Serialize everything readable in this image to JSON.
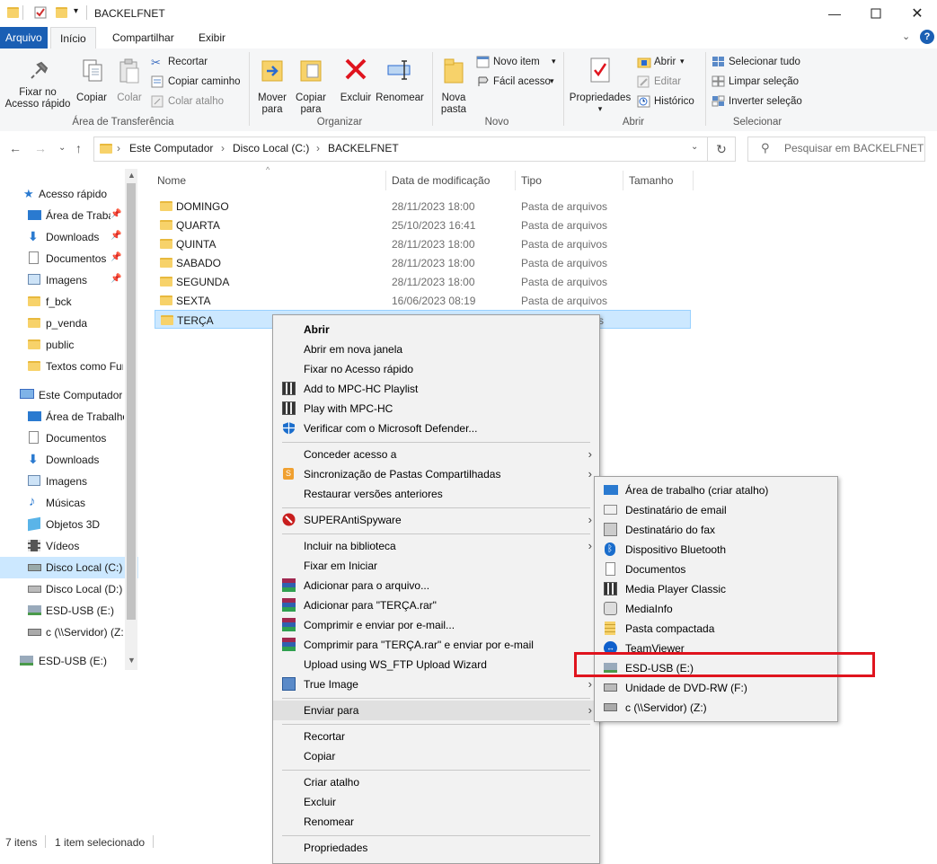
{
  "window": {
    "title": "BACKELFNET"
  },
  "tabs": [
    {
      "label": "Arquivo"
    },
    {
      "label": "Início"
    },
    {
      "label": "Compartilhar"
    },
    {
      "label": "Exibir"
    }
  ],
  "ribbon": {
    "clipboard": {
      "pin_label_1": "Fixar no",
      "pin_label_2": "Acesso rápido",
      "copy": "Copiar",
      "paste": "Colar",
      "cut": "Recortar",
      "copy_path": "Copiar caminho",
      "paste_shortcut": "Colar atalho",
      "group": "Área de Transferência"
    },
    "organize": {
      "move_1": "Mover",
      "move_2": "para",
      "copyto_1": "Copiar",
      "copyto_2": "para",
      "delete": "Excluir",
      "rename": "Renomear",
      "group": "Organizar"
    },
    "new": {
      "folder_1": "Nova",
      "folder_2": "pasta",
      "new_item": "Novo item",
      "easy_access": "Fácil acesso",
      "group": "Novo"
    },
    "open": {
      "properties": "Propriedades",
      "open": "Abrir",
      "edit": "Editar",
      "history": "Histórico",
      "group": "Abrir"
    },
    "select": {
      "all": "Selecionar tudo",
      "none": "Limpar seleção",
      "invert": "Inverter seleção",
      "group": "Selecionar"
    }
  },
  "address": {
    "crumbs": [
      "Este Computador",
      "Disco Local (C:)",
      "BACKELFNET"
    ],
    "search_placeholder": "Pesquisar em BACKELFNET"
  },
  "nav": [
    {
      "label": "Acesso rápido"
    },
    {
      "label": "Área de Traba"
    },
    {
      "label": "Downloads"
    },
    {
      "label": "Documentos"
    },
    {
      "label": "Imagens"
    },
    {
      "label": "f_bck"
    },
    {
      "label": "p_venda"
    },
    {
      "label": "public"
    },
    {
      "label": "Textos como Fun"
    },
    {
      "label": "Este Computador"
    },
    {
      "label": "Área de Trabalho"
    },
    {
      "label": "Documentos"
    },
    {
      "label": "Downloads"
    },
    {
      "label": "Imagens"
    },
    {
      "label": "Músicas"
    },
    {
      "label": "Objetos 3D"
    },
    {
      "label": "Vídeos"
    },
    {
      "label": "Disco Local (C:)"
    },
    {
      "label": "Disco Local (D:)"
    },
    {
      "label": "ESD-USB (E:)"
    },
    {
      "label": "c (\\\\Servidor) (Z:"
    },
    {
      "label": "ESD-USB (E:)"
    }
  ],
  "columns": {
    "name": "Nome",
    "date": "Data de modificação",
    "type": "Tipo",
    "size": "Tamanho"
  },
  "files": [
    {
      "name": "DOMINGO",
      "date": "28/11/2023 18:00",
      "type": "Pasta de arquivos"
    },
    {
      "name": "QUARTA",
      "date": "25/10/2023 16:41",
      "type": "Pasta de arquivos"
    },
    {
      "name": "QUINTA",
      "date": "28/11/2023 18:00",
      "type": "Pasta de arquivos"
    },
    {
      "name": "SABADO",
      "date": "28/11/2023 18:00",
      "type": "Pasta de arquivos"
    },
    {
      "name": "SEGUNDA",
      "date": "28/11/2023 18:00",
      "type": "Pasta de arquivos"
    },
    {
      "name": "SEXTA",
      "date": "16/06/2023 08:19",
      "type": "Pasta de arquivos"
    },
    {
      "name": "TERÇA",
      "date": "",
      "type": "s"
    }
  ],
  "status": {
    "count": "7 itens",
    "selected": "1 item selecionado"
  },
  "context_menu": [
    "Abrir",
    "Abrir em nova janela",
    "Fixar no Acesso rápido",
    "Add to MPC-HC Playlist",
    "Play with MPC-HC",
    "Verificar com o Microsoft Defender...",
    "Conceder acesso a",
    "Sincronização de Pastas Compartilhadas",
    "Restaurar versões anteriores",
    "SUPERAntiSpyware",
    "Incluir na biblioteca",
    "Fixar em Iniciar",
    "Adicionar para o arquivo...",
    "Adicionar para \"TERÇA.rar\"",
    "Comprimir e enviar por e-mail...",
    "Comprimir para \"TERÇA.rar\" e enviar por e-mail",
    "Upload using WS_FTP Upload Wizard",
    "True Image",
    "Enviar para",
    "Recortar",
    "Copiar",
    "Criar atalho",
    "Excluir",
    "Renomear",
    "Propriedades"
  ],
  "sendto_menu": [
    "Área de trabalho (criar atalho)",
    "Destinatário de email",
    "Destinatário do fax",
    "Dispositivo Bluetooth",
    "Documentos",
    "Media Player Classic",
    "MediaInfo",
    "Pasta compactada",
    "TeamViewer",
    "ESD-USB (E:)",
    "Unidade de DVD-RW (F:)",
    "c (\\\\Servidor) (Z:)"
  ],
  "colors": {
    "accent": "#1a5fb4",
    "selection": "#cce8ff",
    "highlight_box": "#e0141e"
  }
}
